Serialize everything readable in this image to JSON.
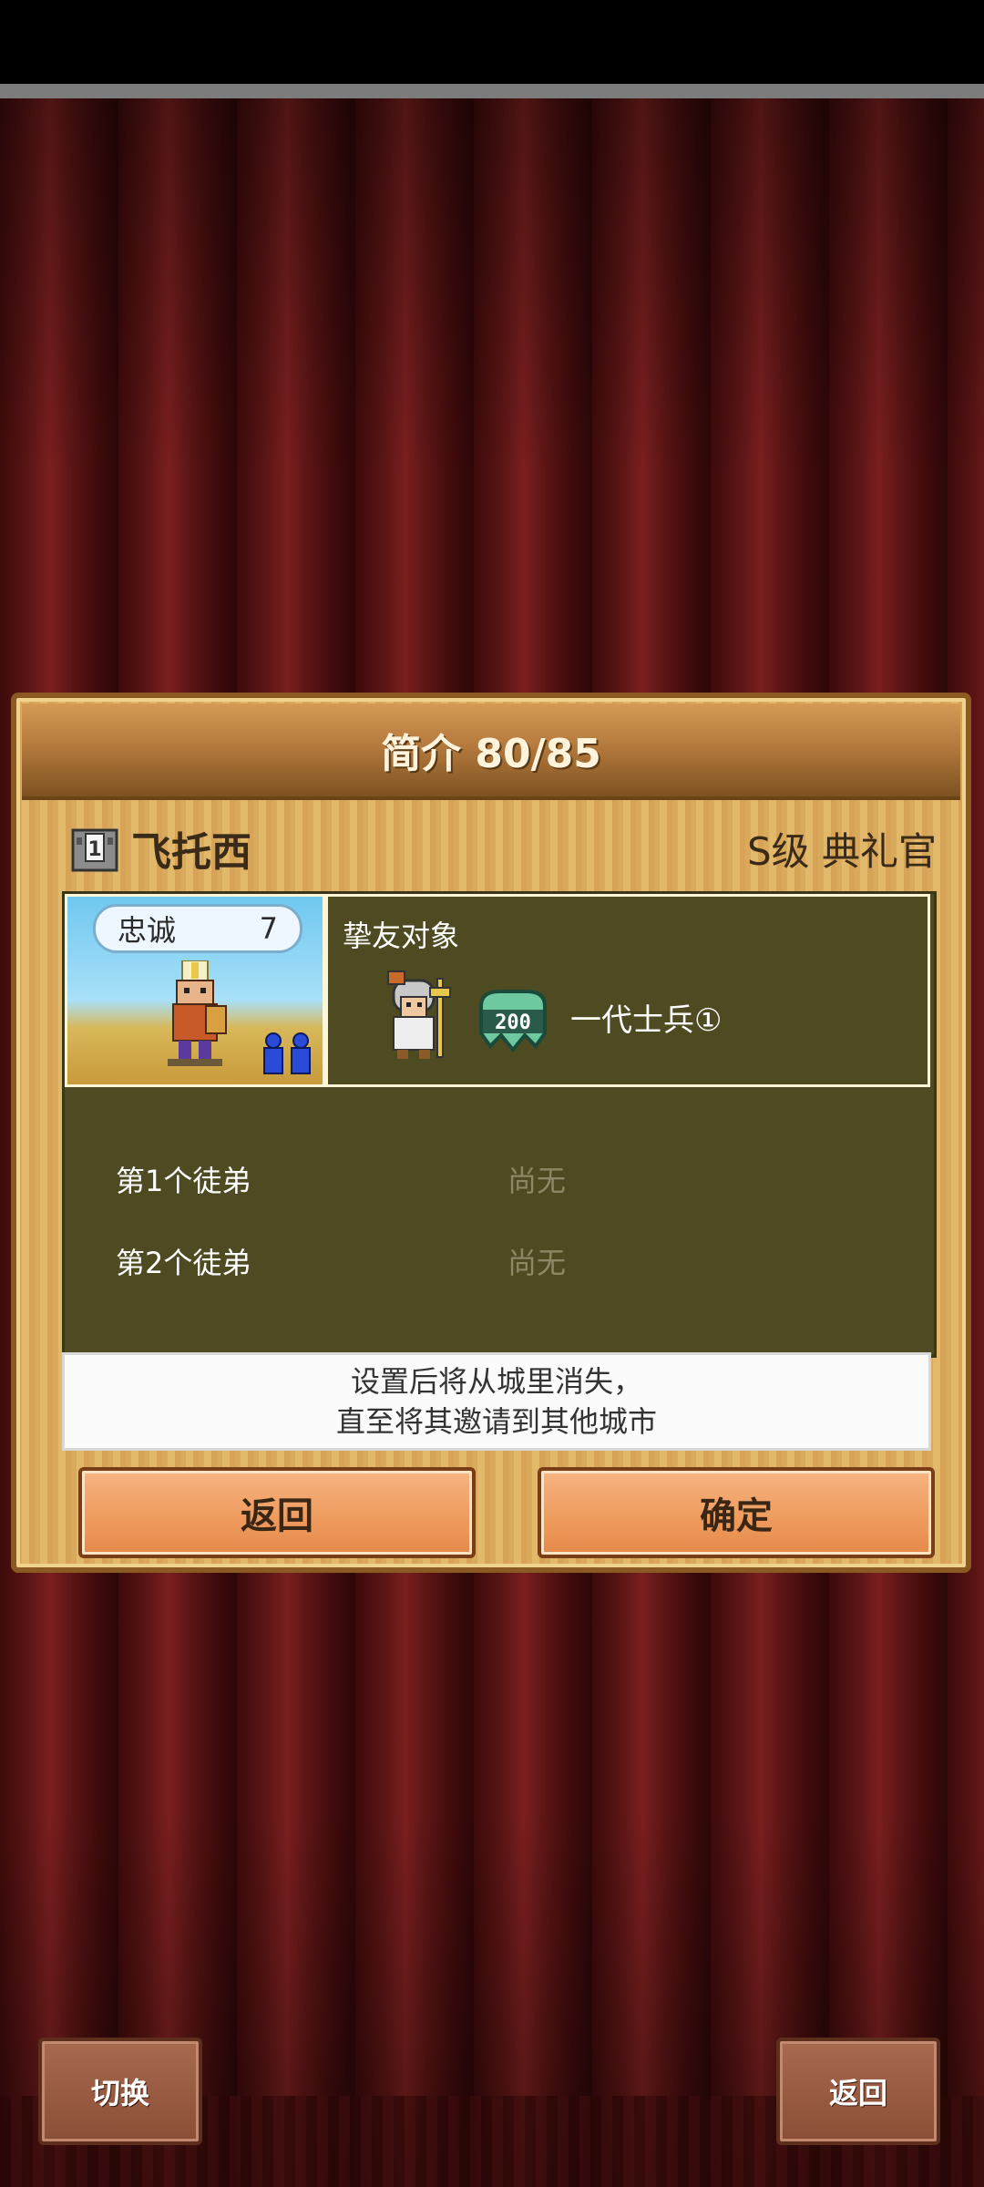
{
  "dialog": {
    "title": "简介 80/85",
    "character": {
      "name": "飞托西",
      "rank": "S级 典礼官",
      "loyalty_label": "忠诚",
      "loyalty_value": "7"
    },
    "friend": {
      "title": "挚友对象",
      "hp_badge": "200",
      "name": "一代士兵①"
    },
    "apprentices": [
      {
        "label": "第1个徒弟",
        "value": "尚无"
      },
      {
        "label": "第2个徒弟",
        "value": "尚无"
      }
    ],
    "notice": {
      "line1": "设置后将从城里消失，",
      "line2": "直至将其邀请到其他城市"
    },
    "buttons": {
      "back": "返回",
      "confirm": "确定"
    }
  },
  "bottom": {
    "switch": "切换",
    "back": "返回"
  },
  "colors": {
    "panel_olive": "#4e4a22",
    "button_orange": "#ee9a5c",
    "curtain_red": "#5a1414"
  }
}
